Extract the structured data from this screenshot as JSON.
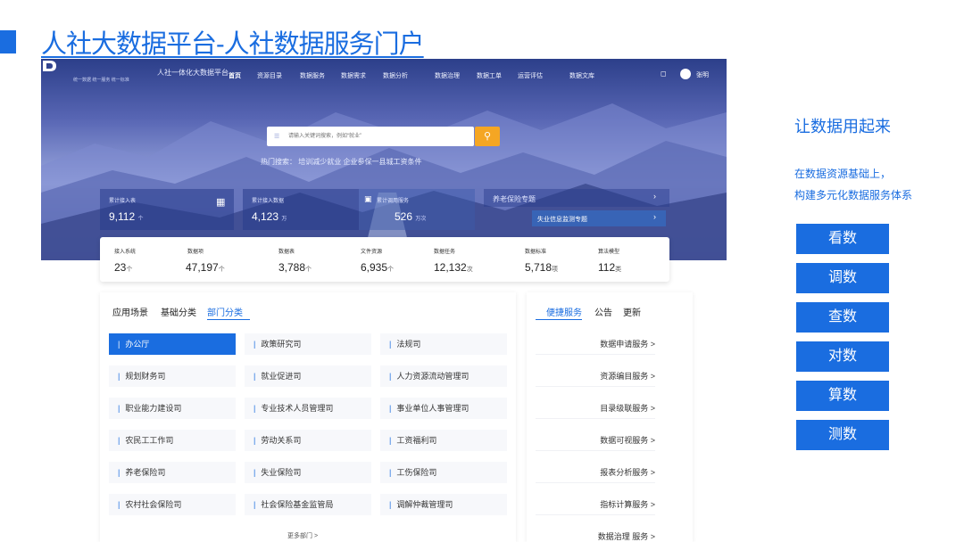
{
  "slide": {
    "title": "人社大数据平台-人社数据服务门户",
    "tagline": "让数据用起来",
    "description_lines": [
      "在数据资源基础上，",
      "构建多元化数据服务体系"
    ],
    "actions": [
      "看数",
      "调数",
      "查数",
      "对数",
      "算数",
      "测数"
    ],
    "accent_color": "#1a6de0"
  },
  "portal": {
    "logo_sub": "统一数据 统一服务 统一标准",
    "platform_name": "人社一体化大数据平台",
    "nav": [
      "首页",
      "资源目录",
      "数据服务",
      "数据需求",
      "数据分析",
      "数据治理",
      "数据工单",
      "运营评估",
      "数据文库"
    ],
    "user_name": "张明",
    "search": {
      "placeholder": "请输入关键词搜索，例如“就业”",
      "hot": "热门搜索：  培训减少就业   企业参保一县城工资条件"
    },
    "panels": {
      "left": [
        {
          "label": "累计接入表",
          "value": "9,112",
          "unit": "个"
        },
        {
          "label": "累计接入数据",
          "value": "4,123",
          "unit": "万"
        }
      ],
      "service": {
        "label": "累计调用服务",
        "value": "526",
        "unit": "万次"
      },
      "topic": {
        "label": "养老保险专题"
      },
      "topic2": {
        "label": "失业信息监测专题"
      }
    },
    "metrics": [
      {
        "label": "接入系统",
        "value": "23",
        "unit": "个"
      },
      {
        "label": "数据项",
        "value": "47,197",
        "unit": "个"
      },
      {
        "label": "数据表",
        "value": "3,788",
        "unit": "个"
      },
      {
        "label": "文件资源",
        "value": "6,935",
        "unit": "个"
      },
      {
        "label": "数据任务",
        "value": "12,132",
        "unit": "次"
      },
      {
        "label": "数据标准",
        "value": "5,718",
        "unit": "项"
      },
      {
        "label": "算法模型",
        "value": "112",
        "unit": "类"
      }
    ],
    "dept_tabs": [
      "应用场景",
      "基础分类",
      "部门分类"
    ],
    "departments": [
      "办公厅",
      "政策研究司",
      "法规司",
      "规划财务司",
      "就业促进司",
      "人力资源流动管理司",
      "职业能力建设司",
      "专业技术人员管理司",
      "事业单位人事管理司",
      "农民工工作司",
      "劳动关系司",
      "工资福利司",
      "养老保险司",
      "失业保险司",
      "工伤保险司",
      "农村社会保险司",
      "社会保险基金监管局",
      "调解仲裁管理司"
    ],
    "more_depts": "更多部门 >",
    "svc_tabs": [
      "便捷服务",
      "公告",
      "更新"
    ],
    "services": [
      "数据申请服务 >",
      "资源编目服务 >",
      "目录级联服务 >",
      "数据可视服务 >",
      "报表分析服务 >",
      "指标计算服务 >",
      "数据治理 服务 >"
    ]
  }
}
